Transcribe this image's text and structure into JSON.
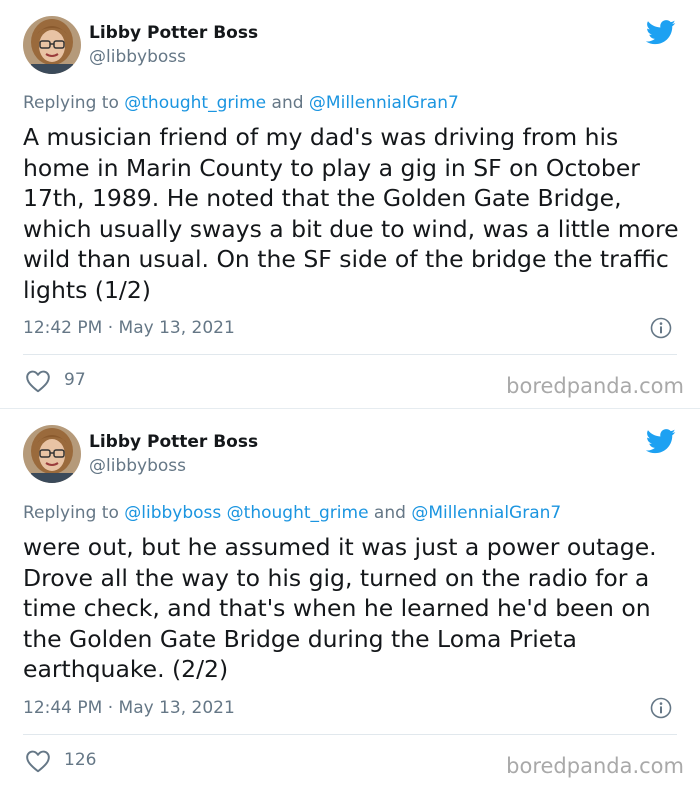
{
  "tweets": [
    {
      "author_name": "Libby Potter Boss",
      "author_handle": "@libbyboss",
      "replying_prefix": "Replying to ",
      "replying_mentions": [
        "@thought_grime",
        "@MillennialGran7"
      ],
      "replying_joiner": " and ",
      "text": "A musician friend of my dad's was driving from his home in Marin County to play a gig in SF on October 17th, 1989. He noted that the Golden Gate Bridge, which usually sways a bit due to wind, was a little more wild than usual. On the SF side of the bridge the traffic lights (1/2)",
      "time": "12:42 PM",
      "date": "May 13, 2021",
      "timestamp": "12:42 PM · May 13, 2021",
      "likes": "97",
      "watermark": "boredpanda.com"
    },
    {
      "author_name": "Libby Potter Boss",
      "author_handle": "@libbyboss",
      "replying_prefix": "Replying to ",
      "replying_mentions": [
        "@libbyboss",
        "@thought_grime",
        "@MillennialGran7"
      ],
      "replying_joiner": " and ",
      "text": "were out, but he assumed it was just a power outage. Drove all the way to his gig, turned on the radio for a time check, and that's when he learned he'd been on the Golden Gate Bridge during the Loma Prieta earthquake. (2/2)",
      "time": "12:44 PM",
      "date": "May 13, 2021",
      "timestamp": "12:44 PM · May 13, 2021",
      "likes": "126",
      "watermark": "boredpanda.com"
    }
  ],
  "colors": {
    "twitter_blue": "#1da1f2",
    "link_blue": "#1b95e0",
    "secondary_text": "#657786",
    "primary_text": "#14171a",
    "watermark": "#a9a9a9"
  },
  "icons": {
    "brand": "twitter-bird-icon",
    "info": "info-icon",
    "like": "heart-outline-icon"
  }
}
